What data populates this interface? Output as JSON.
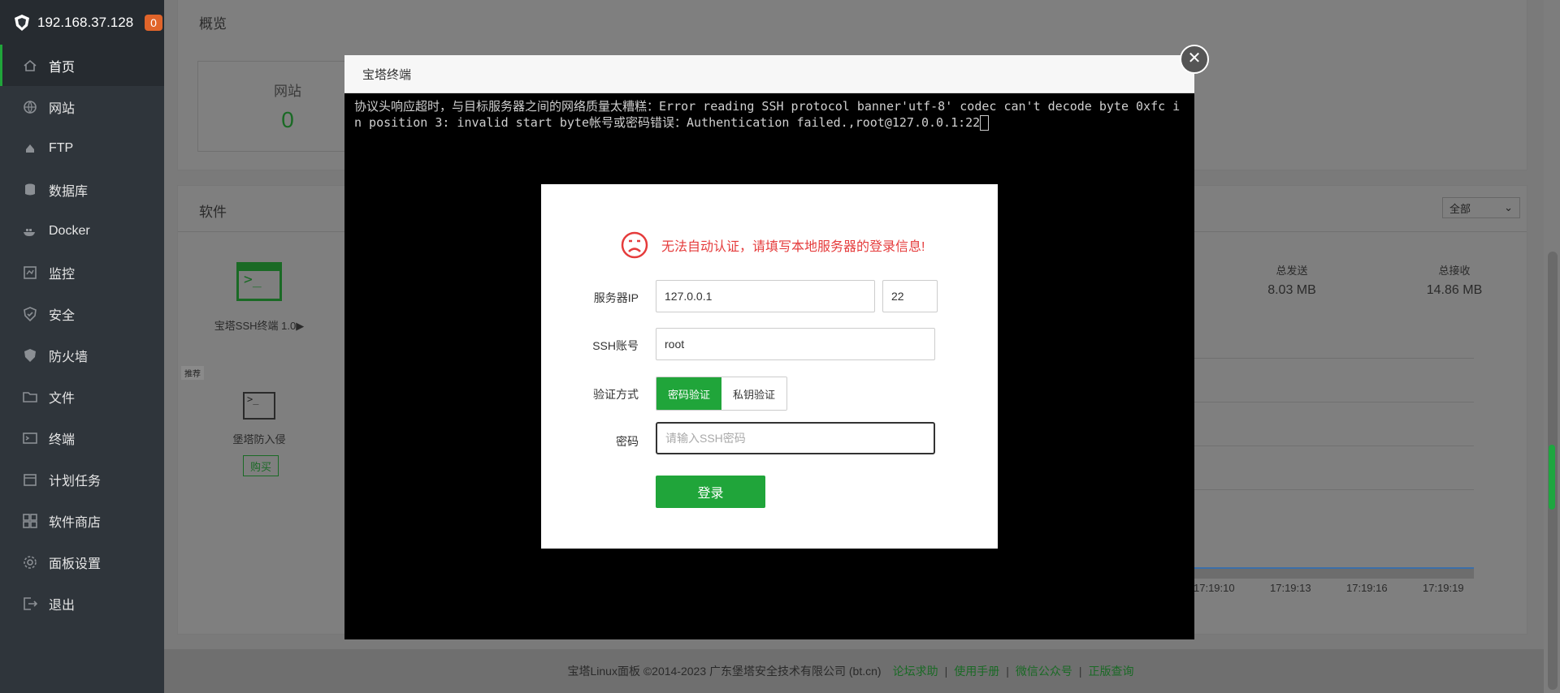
{
  "sidebar": {
    "host": "192.168.37.128",
    "badge": "0",
    "items": [
      {
        "label": "首页",
        "icon": "home-icon"
      },
      {
        "label": "网站",
        "icon": "globe-icon"
      },
      {
        "label": "FTP",
        "icon": "ftp-icon"
      },
      {
        "label": "数据库",
        "icon": "database-icon"
      },
      {
        "label": "Docker",
        "icon": "docker-icon"
      },
      {
        "label": "监控",
        "icon": "monitor-icon"
      },
      {
        "label": "安全",
        "icon": "shield-icon"
      },
      {
        "label": "防火墙",
        "icon": "firewall-icon"
      },
      {
        "label": "文件",
        "icon": "folder-icon"
      },
      {
        "label": "终端",
        "icon": "terminal-icon"
      },
      {
        "label": "计划任务",
        "icon": "calendar-icon"
      },
      {
        "label": "软件商店",
        "icon": "grid-icon"
      },
      {
        "label": "面板设置",
        "icon": "gear-icon"
      },
      {
        "label": "退出",
        "icon": "logout-icon"
      }
    ]
  },
  "overview": {
    "title": "概览",
    "site_label": "网站",
    "site_count": "0"
  },
  "software": {
    "title": "软件",
    "filter": "全部",
    "ssh_name": "宝塔SSH终端 1.0▶",
    "recommend_tag": "推荐",
    "intrusion_name": "堡塔防入侵",
    "buy_label": "购买"
  },
  "traffic": {
    "sent_label": "总发送",
    "sent_value": "8.03 MB",
    "recv_label": "总接收",
    "recv_value": "14.86 MB",
    "times": [
      "17:19:10",
      "17:19:13",
      "17:19:16",
      "17:19:19"
    ]
  },
  "terminal": {
    "title": "宝塔终端",
    "output": "协议头响应超时，与目标服务器之间的网络质量太糟糕：Error reading SSH protocol banner'utf-8' codec can't decode byte 0xfc in position 3: invalid start byte帐号或密码错误：Authentication failed.,root@127.0.0.1:22"
  },
  "login": {
    "error_message": "无法自动认证，请填写本地服务器的登录信息!",
    "server_ip_label": "服务器IP",
    "server_ip": "127.0.0.1",
    "port": "22",
    "ssh_account_label": "SSH账号",
    "ssh_account": "root",
    "auth_method_label": "验证方式",
    "auth_password": "密码验证",
    "auth_key": "私钥验证",
    "password_label": "密码",
    "password_placeholder": "请输入SSH密码",
    "login_button": "登录"
  },
  "footer": {
    "copyright": "宝塔Linux面板 ©2014-2023 广东堡塔安全技术有限公司 (bt.cn)",
    "links": [
      "论坛求助",
      "使用手册",
      "微信公众号",
      "正版查询"
    ]
  },
  "colors": {
    "accent": "#20a53a",
    "error": "#e53c3c",
    "sidebar": "#2f353b"
  }
}
